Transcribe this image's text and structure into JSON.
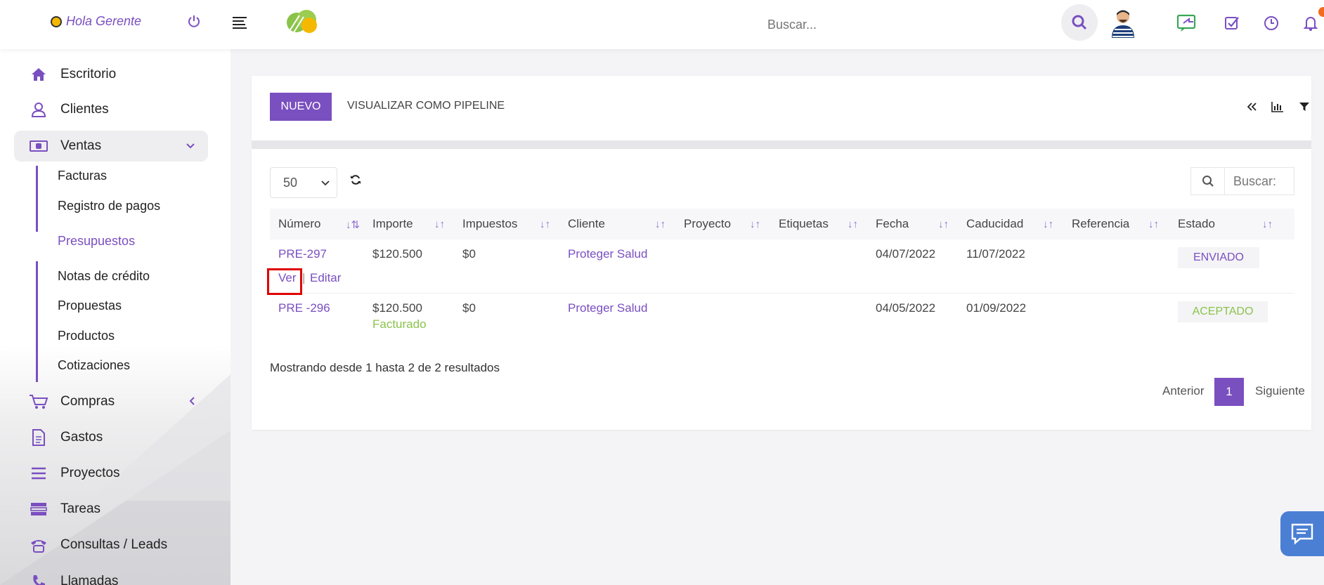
{
  "header": {
    "greeting": "Hola Gerente",
    "search_placeholder": "Buscar..."
  },
  "sidebar": {
    "items": [
      {
        "label": "Escritorio",
        "icon": "home-icon"
      },
      {
        "label": "Clientes",
        "icon": "user-icon"
      },
      {
        "label": "Ventas",
        "icon": "money-icon"
      },
      {
        "label": "Compras",
        "icon": "cart-icon"
      },
      {
        "label": "Gastos",
        "icon": "document-icon"
      },
      {
        "label": "Proyectos",
        "icon": "list-icon"
      },
      {
        "label": "Tareas",
        "icon": "tasks-icon"
      },
      {
        "label": "Consultas / Leads",
        "icon": "phone-icon"
      },
      {
        "label": "Llamadas",
        "icon": "call-icon"
      }
    ],
    "ventas_sub": [
      "Facturas",
      "Registro de pagos",
      "Presupuestos",
      "Notas de crédito",
      "Propuestas",
      "Productos",
      "Cotizaciones"
    ]
  },
  "toolbar": {
    "new_label": "NUEVO",
    "pipeline_label": "VISUALIZAR COMO PIPELINE"
  },
  "table": {
    "page_length": "50",
    "search_placeholder": "Buscar:",
    "columns": [
      "Número",
      "Importe",
      "Impuestos",
      "Cliente",
      "Proyecto",
      "Etiquetas",
      "Fecha",
      "Caducidad",
      "Referencia",
      "Estado"
    ],
    "rows": [
      {
        "numero": "PRE-297",
        "importe": "$120.500",
        "impuestos": "$0",
        "cliente": "Proteger Salud",
        "fecha": "04/07/2022",
        "caducidad": "11/07/2022",
        "estado": "ENVIADO",
        "action_view": "Ver",
        "action_sep": "|",
        "action_edit": "Editar"
      },
      {
        "numero": "PRE -296",
        "importe": "$120.500",
        "importe_note": "Facturado",
        "impuestos": "$0",
        "cliente": "Proteger Salud",
        "fecha": "04/05/2022",
        "caducidad": "01/09/2022",
        "estado": "ACEPTADO"
      }
    ],
    "summary": "Mostrando desde 1 hasta 2 de 2 resultados",
    "pagination": {
      "prev": "Anterior",
      "current": "1",
      "next": "Siguiente"
    }
  },
  "colors": {
    "accent": "#7a4fc0",
    "success": "#8bc34a",
    "chat": "#4a7fd4",
    "badge": "#f26b1d"
  }
}
